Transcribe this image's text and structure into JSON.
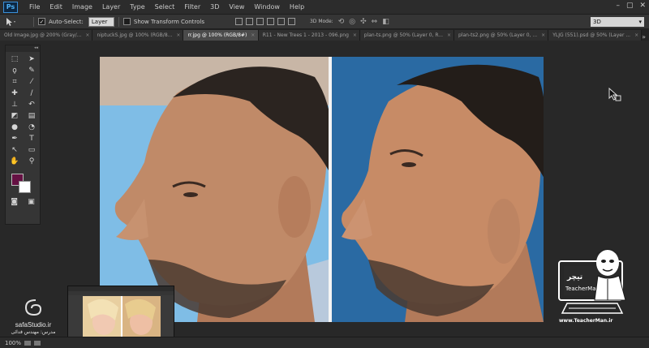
{
  "menubar": {
    "logo": "Ps",
    "items": [
      "File",
      "Edit",
      "Image",
      "Layer",
      "Type",
      "Select",
      "Filter",
      "3D",
      "View",
      "Window",
      "Help"
    ],
    "window_controls": [
      "–",
      "▢",
      "✕"
    ]
  },
  "options": {
    "auto_select_label": "Auto-Select:",
    "auto_select_checked": true,
    "auto_select_value": "Layer",
    "transform_label": "Show Transform Controls",
    "transform_checked": false,
    "mode_3d_label": "3D Mode:",
    "workspace_value": "3D"
  },
  "tabs": [
    {
      "label": "Old Image.jpg @ 200% (Gray/...",
      "active": false
    },
    {
      "label": "niptuckS.jpg @ 100% (RGB/8...",
      "active": false
    },
    {
      "label": "rr.jpg @ 100% (RGB/8#)",
      "active": true
    },
    {
      "label": "R11 - New Trees 1 - 2013 - 096.png",
      "active": false
    },
    {
      "label": "plan-ts.png @ 50% (Layer 0, R...",
      "active": false
    },
    {
      "label": "plan-ts2.png @ 50% (Layer 0, ...",
      "active": false
    },
    {
      "label": "YLJG (551).psd @ 50% (Layer ...",
      "active": false
    }
  ],
  "tabs_more": "»",
  "toolbar": {
    "collapse": "◂◂",
    "tools": [
      "marquee-icon",
      "move-icon",
      "lasso-icon",
      "quick-select-icon",
      "crop-icon",
      "eyedropper-icon",
      "healing-icon",
      "brush-icon",
      "stamp-icon",
      "history-brush-icon",
      "eraser-icon",
      "gradient-icon",
      "blur-icon",
      "dodge-icon",
      "pen-icon",
      "type-icon",
      "path-select-icon",
      "shape-icon",
      "hand-icon",
      "zoom-icon"
    ],
    "foreground_color": "#651143",
    "background_color": "#ffffff"
  },
  "status": {
    "zoom": "100%"
  },
  "branding": {
    "left_site": "safaStudio.ir",
    "left_sub": "مدرس: مهندس فدائی",
    "right_url": "www.TeacherMan.ir",
    "right_name": "TeacherMan"
  }
}
